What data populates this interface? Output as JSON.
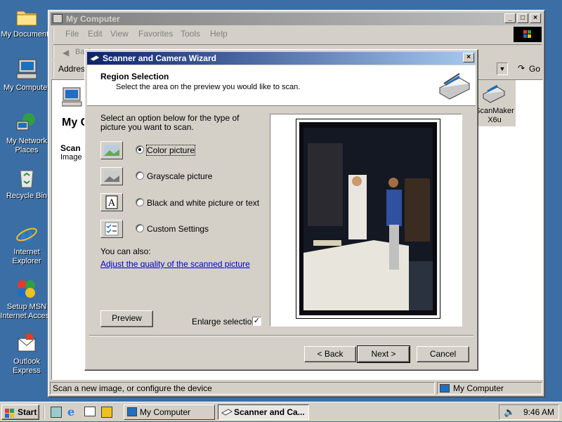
{
  "desktop": {
    "icons": [
      {
        "label": "My Documents",
        "icon": "folder-icon"
      },
      {
        "label": "My Computer",
        "icon": "computer-icon"
      },
      {
        "label": "My Network Places",
        "icon": "network-icon"
      },
      {
        "label": "Recycle Bin",
        "icon": "recycle-bin-icon"
      },
      {
        "label": "Internet Explorer",
        "icon": "internet-explorer-icon"
      },
      {
        "label": "Setup MSN Internet Access",
        "icon": "msn-icon"
      },
      {
        "label": "Outlook Express",
        "icon": "outlook-express-icon"
      }
    ]
  },
  "explorer": {
    "title": "My Computer",
    "menu": [
      "File",
      "Edit",
      "View",
      "Favorites",
      "Tools",
      "Help"
    ],
    "toolbar_back": "Back",
    "address_label": "Address",
    "go_label": "Go",
    "folder_header": "My C",
    "selected_name": "Scan",
    "selected_type": "Image",
    "item_label": "ScanMaker X6u",
    "status_left": "Scan a new image, or configure the device",
    "status_right": "My Computer"
  },
  "wizard": {
    "title": "Scanner and Camera Wizard",
    "heading": "Region Selection",
    "subheading": "Select the area on the preview you would like to scan.",
    "prompt": "Select an option below for the type of picture you want to scan.",
    "options": [
      {
        "label": "Color picture",
        "selected": true,
        "icon": "color-picture-icon"
      },
      {
        "label": "Grayscale picture",
        "selected": false,
        "icon": "grayscale-picture-icon"
      },
      {
        "label": "Black and white picture or text",
        "selected": false,
        "icon": "black-white-text-icon"
      },
      {
        "label": "Custom Settings",
        "selected": false,
        "icon": "custom-settings-icon"
      }
    ],
    "also_label": "You can also:",
    "adjust_link": "Adjust the quality of the scanned picture",
    "preview_button": "Preview",
    "enlarge_label": "Enlarge selection",
    "enlarge_checked": true,
    "back_button": "< Back",
    "next_button": "Next >",
    "cancel_button": "Cancel"
  },
  "taskbar": {
    "start_label": "Start",
    "tasks": [
      "My Computer",
      "Scanner and Ca..."
    ],
    "clock": "9:46 AM"
  }
}
